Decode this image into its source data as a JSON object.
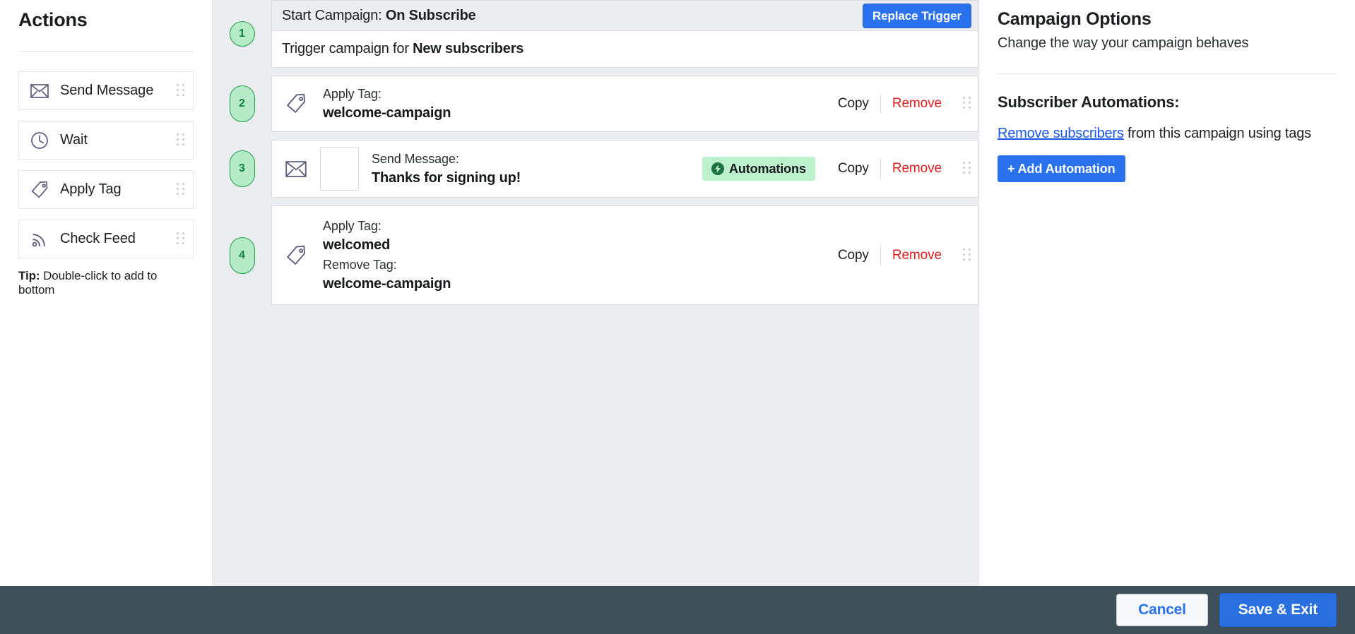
{
  "sidebar": {
    "title": "Actions",
    "items": [
      {
        "label": "Send Message",
        "icon": "envelope-icon"
      },
      {
        "label": "Wait",
        "icon": "clock-icon"
      },
      {
        "label": "Apply Tag",
        "icon": "tag-icon"
      },
      {
        "label": "Check Feed",
        "icon": "rss-feed-icon"
      }
    ],
    "tip_prefix": "Tip:",
    "tip_text": "Double-click to add to bottom"
  },
  "canvas": {
    "steps": [
      {
        "number": "1",
        "type": "trigger",
        "head_label": "Start Campaign:",
        "head_value": "On Subscribe",
        "replace_button": "Replace Trigger",
        "body_label": "Trigger campaign for",
        "body_value": "New subscribers"
      },
      {
        "number": "2",
        "type": "apply-tag",
        "icon": "tag-icon",
        "label": "Apply Tag:",
        "value": "welcome-campaign",
        "copy_label": "Copy",
        "remove_label": "Remove"
      },
      {
        "number": "3",
        "type": "send-message",
        "icon": "envelope-icon",
        "label": "Send Message:",
        "value": "Thanks for signing up!",
        "badge_label": "Automations",
        "copy_label": "Copy",
        "remove_label": "Remove"
      },
      {
        "number": "4",
        "type": "tag-pair",
        "icon": "tag-icon",
        "label": "Apply Tag:",
        "value": "welcomed",
        "label2": "Remove Tag:",
        "value2": "welcome-campaign",
        "copy_label": "Copy",
        "remove_label": "Remove"
      }
    ]
  },
  "right_panel": {
    "title": "Campaign Options",
    "subtitle": "Change the way your campaign behaves",
    "section_title": "Subscriber Automations:",
    "link_text": "Remove subscribers",
    "line_rest": " from this campaign using tags",
    "add_button": "+ Add Automation"
  },
  "footer": {
    "cancel_label": "Cancel",
    "save_label": "Save & Exit"
  },
  "colors": {
    "accent_blue": "#2a71ee",
    "danger_red": "#e02020",
    "badge_green_bg": "#b6ebc8",
    "badge_green_border": "#1f9d4d",
    "badge_green_text": "#15803d",
    "automations_chip_bg": "#bdf0cd",
    "footer_bg": "#3f4f5a",
    "canvas_bg": "#ebedf1",
    "icon_slate": "#5b5f7d"
  }
}
